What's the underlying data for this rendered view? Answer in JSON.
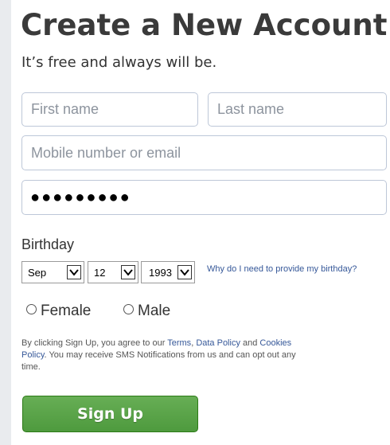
{
  "header": {
    "title": "Create a New Account",
    "subtitle": "It’s free and always will be."
  },
  "form": {
    "first_name": {
      "value": "",
      "placeholder": "First name"
    },
    "last_name": {
      "value": "",
      "placeholder": "Last name"
    },
    "contact": {
      "value": "",
      "placeholder": "Mobile number or email"
    },
    "password": {
      "masked_value": "●●●●●●●●●"
    }
  },
  "birthday": {
    "label": "Birthday",
    "month": "Sep",
    "day": "12",
    "year": "1993",
    "why_link": "Why do I need to provide my birthday?"
  },
  "gender": {
    "options": [
      {
        "label": "Female",
        "selected": false
      },
      {
        "label": "Male",
        "selected": false
      }
    ]
  },
  "terms": {
    "prefix": "By clicking Sign Up, you agree to our ",
    "terms_link": "Terms",
    "sep1": ", ",
    "data_policy_link": "Data Policy",
    "sep2": " and ",
    "cookies_link": "Cookies Policy",
    "suffix": ". You may receive SMS Notifications from us and can opt out any time."
  },
  "signup_button": {
    "label": "Sign Up"
  },
  "colors": {
    "link": "#365899",
    "button": "#4e9a3e",
    "background": "#e9ebee"
  }
}
